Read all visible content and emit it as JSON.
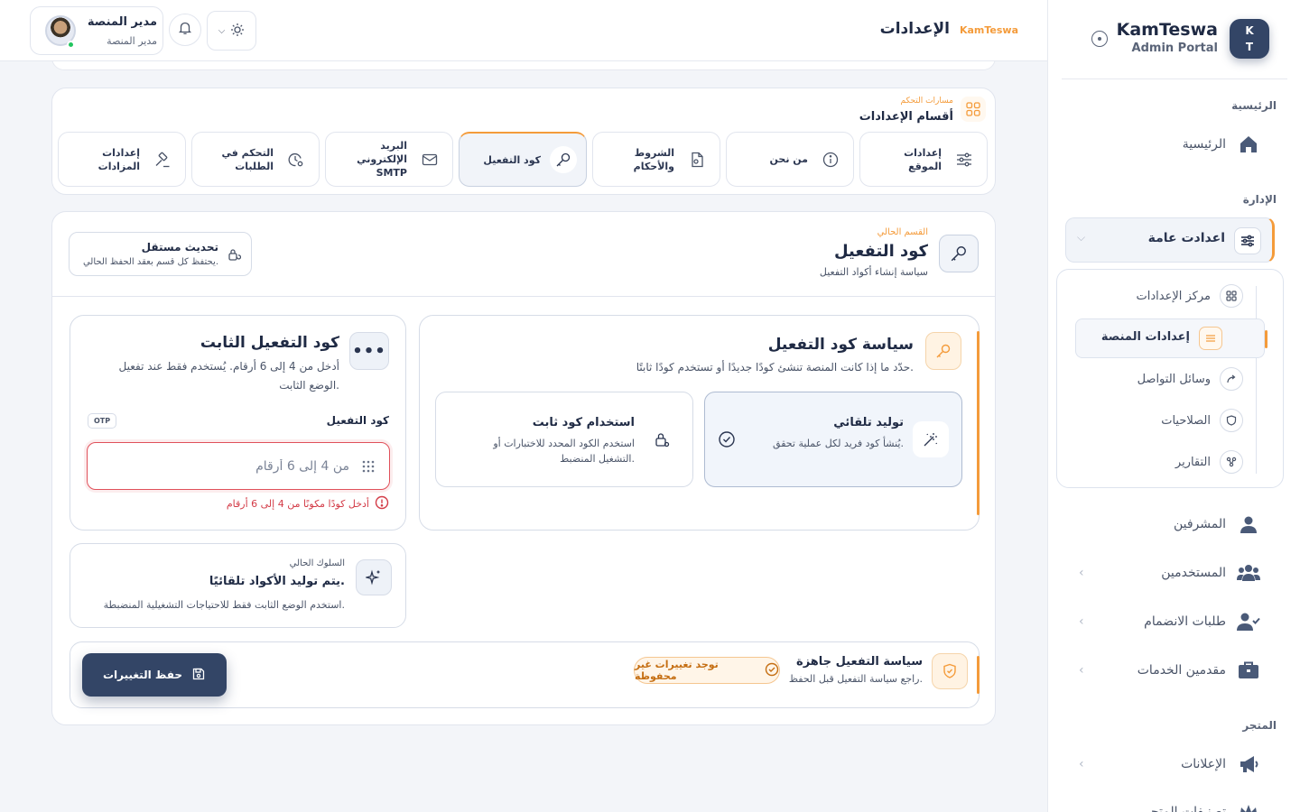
{
  "sidebar": {
    "brand": {
      "logo_top": "K",
      "logo_bottom": "T",
      "name": "KamTeswa",
      "subtitle": "Admin Portal"
    },
    "sections": {
      "home": "الرئيسية",
      "management": "الإدارة",
      "store": "المتجر"
    },
    "items": {
      "home": "الرئيسية",
      "general_settings": "اعدادت عامة",
      "supervisors": "المشرفين",
      "users": "المستخدمين",
      "join_requests": "طلبات الانضمام",
      "service_providers": "مقدمين الخدمات",
      "ads": "الإعلانات",
      "partial_bottom": "تصنيفات المتجر"
    },
    "submenu": {
      "settings_center": "مركز الإعدادات",
      "platform_settings": "إعدادات المنصة",
      "social_media": "وسائل التواصل",
      "permissions": "الصلاحيات",
      "reports": "التقارير"
    }
  },
  "topbar": {
    "title": "الإعدادات",
    "brand": "KamTeswa",
    "user_name": "مدير المنصة",
    "user_role": "مدير المنصة"
  },
  "tabs_card": {
    "kicker": "مسارات التحكم",
    "title": "أقسام الإعدادات",
    "tabs": {
      "site_settings": "إعدادات الموقع",
      "about_us": "من نحن",
      "terms": "الشروط والأحكام",
      "activation_code": "كود التفعيل",
      "smtp_line1": "البريد الإلكتروني",
      "smtp_line2": "SMTP",
      "requests_control": "التحكم في الطلبات",
      "auction_settings": "إعدادات المزادات"
    }
  },
  "section": {
    "kicker": "القسم الحالي",
    "title": "كود التفعيل",
    "subtitle": "سياسة إنشاء أكواد التفعيل",
    "independent_title": "تحديث مستقل",
    "independent_sub": "يحتفظ كل قسم بعقد الحفظ الحالي."
  },
  "policy": {
    "title": "سياسة كود التفعيل",
    "subtitle": "حدّد ما إذا كانت المنصة تنشئ كودًا جديدًا أو تستخدم كودًا ثابتًا.",
    "auto_title": "توليد تلقائي",
    "auto_desc": "يُنشأ كود فريد لكل عملية تحقق.",
    "fixed_title": "استخدام كود ثابت",
    "fixed_desc": "استخدم الكود المحدد للاختبارات أو التشغيل المنضبط.",
    "selected": "auto"
  },
  "fixed_code": {
    "title": "كود التفعيل الثابت",
    "subtitle": "أدخل من 4 إلى 6 أرقام. يُستخدم فقط عند تفعيل الوضع الثابت.",
    "more_label": "•••",
    "field_label": "كود التفعيل",
    "tag": "OTP",
    "value": "",
    "placeholder": "من 4 إلى 6 أرقام",
    "error": "أدخل كودًا مكونًا من 4 إلى 6 أرقام"
  },
  "behavior": {
    "kicker": "السلوك الحالي",
    "title": "يتم توليد الأكواد تلقائيًا.",
    "subtitle": "استخدم الوضع الثابت فقط للاحتياجات التشغيلية المنضبطة."
  },
  "footer": {
    "title": "سياسة التفعيل جاهزة",
    "subtitle": "راجع سياسة التفعيل قبل الحفظ.",
    "unsaved": "توجد تغييرات غير محفوظة",
    "save": "حفظ التغييرات"
  },
  "colors": {
    "accent": "#f49b3a",
    "primary": "#334566",
    "error": "#d33b47",
    "online": "#22c55e"
  }
}
